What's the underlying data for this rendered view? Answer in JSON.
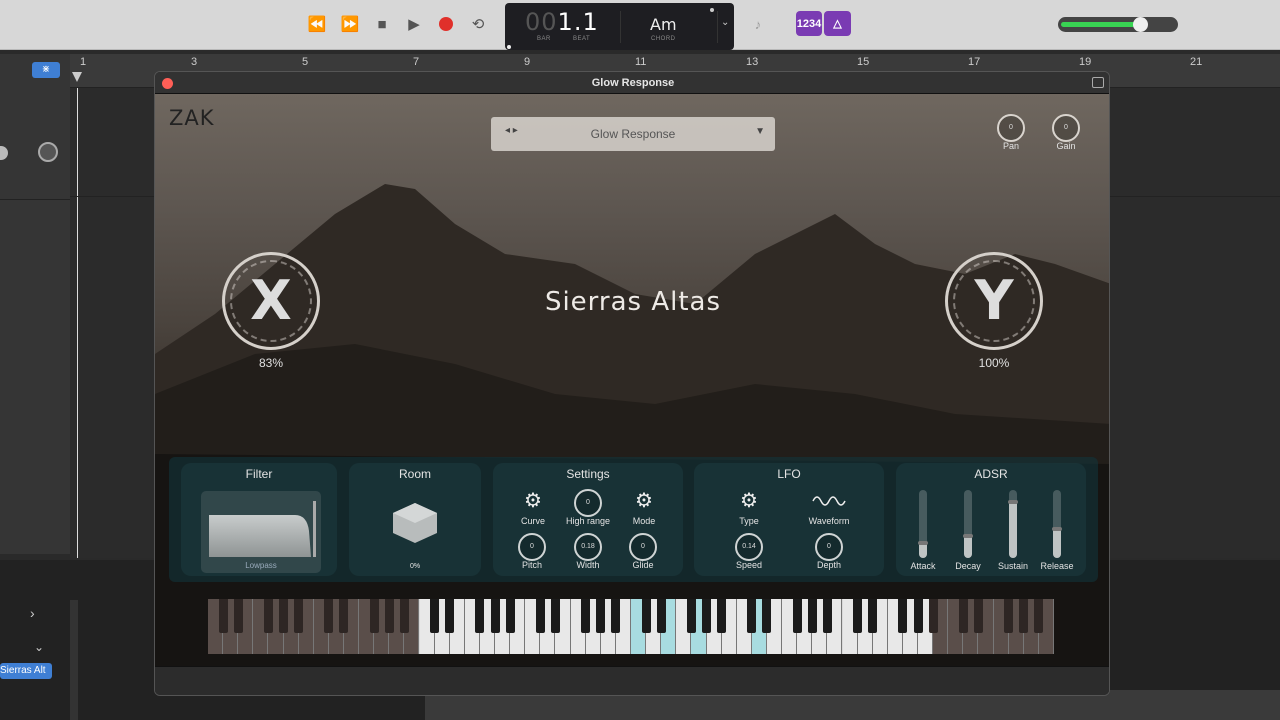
{
  "transport": {
    "position_dim": "00",
    "position": "1.1",
    "bar_label": "BAR",
    "beat_label": "BEAT",
    "chord": "Am",
    "chord_label": "CHORD",
    "count_in": "1234"
  },
  "ruler": {
    "ticks": [
      "1",
      "3",
      "5",
      "7",
      "9",
      "11",
      "13",
      "15",
      "17",
      "19",
      "21"
    ]
  },
  "track": {
    "region_name": "Sierras Alt"
  },
  "plugin": {
    "window_title": "Glow Response",
    "brand": "ZAK",
    "preset_name": "Glow Response",
    "instrument_name": "Sierras Altas",
    "pan": {
      "label": "Pan",
      "value": "0"
    },
    "gain": {
      "label": "Gain",
      "value": "0"
    },
    "x_knob": {
      "letter": "X",
      "value": "83%"
    },
    "y_knob": {
      "letter": "Y",
      "value": "100%"
    },
    "filter": {
      "title": "Filter",
      "type": "Lowpass"
    },
    "room": {
      "title": "Room",
      "value": "0%"
    },
    "settings": {
      "title": "Settings",
      "curve": "Curve",
      "high_range": {
        "label": "High range",
        "value": "0"
      },
      "mode": "Mode",
      "pitch": {
        "label": "Pitch",
        "value": "0"
      },
      "width": {
        "label": "Width",
        "value": "0.18"
      },
      "glide": {
        "label": "Glide",
        "value": "0"
      }
    },
    "lfo": {
      "title": "LFO",
      "type": "Type",
      "waveform": "Waveform",
      "speed": {
        "label": "Speed",
        "value": "0.14"
      },
      "depth": {
        "label": "Depth",
        "value": "0"
      }
    },
    "adsr": {
      "title": "ADSR",
      "attack": {
        "label": "Attack",
        "level": 0.25
      },
      "decay": {
        "label": "Decay",
        "level": 0.35
      },
      "sustain": {
        "label": "Sustain",
        "level": 0.85
      },
      "release": {
        "label": "Release",
        "level": 0.45
      }
    }
  },
  "colors": {
    "accent": "#7a3bb3",
    "record": "#e0302a",
    "volume": "#39d353",
    "panel": "#123a40",
    "highlight_key": "#a8dce0"
  }
}
